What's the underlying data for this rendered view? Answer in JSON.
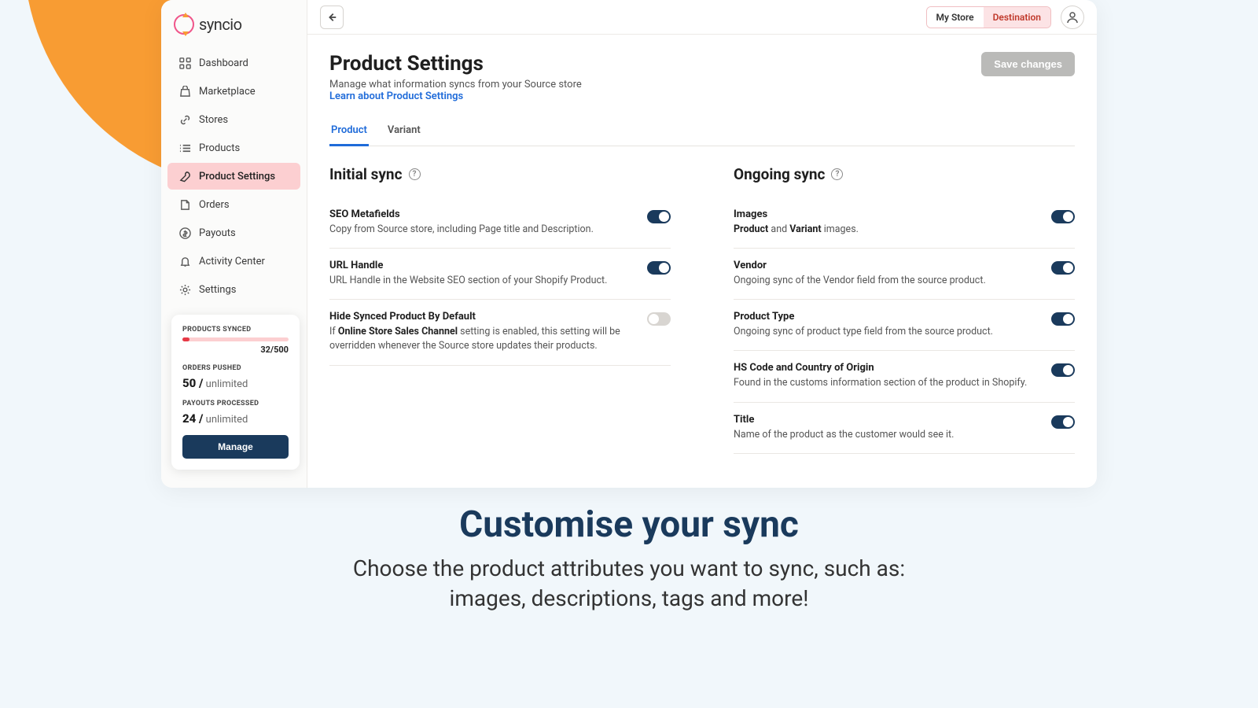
{
  "brand": "syncio",
  "nav": [
    {
      "label": "Dashboard",
      "icon": "grid"
    },
    {
      "label": "Marketplace",
      "icon": "bag"
    },
    {
      "label": "Stores",
      "icon": "link"
    },
    {
      "label": "Products",
      "icon": "list"
    },
    {
      "label": "Product Settings",
      "icon": "wrench",
      "active": true
    },
    {
      "label": "Orders",
      "icon": "file"
    },
    {
      "label": "Payouts",
      "icon": "dollar"
    },
    {
      "label": "Activity Center",
      "icon": "bell"
    },
    {
      "label": "Settings",
      "icon": "cog"
    }
  ],
  "topbar": {
    "my_store": "My Store",
    "destination": "Destination"
  },
  "page": {
    "title": "Product Settings",
    "subtitle": "Manage what information syncs from your Source store",
    "learn": "Learn about Product Settings",
    "save": "Save changes"
  },
  "tabs": [
    {
      "label": "Product",
      "active": true
    },
    {
      "label": "Variant",
      "active": false
    }
  ],
  "initial": {
    "heading": "Initial sync",
    "rows": [
      {
        "title": "SEO Metafields",
        "desc": "Copy from Source store, including Page title and Description.",
        "on": true
      },
      {
        "title": "URL Handle",
        "desc": "URL Handle in the Website SEO section of your Shopify Product.",
        "on": true
      },
      {
        "title": "Hide Synced Product By Default",
        "desc_pre": "If ",
        "desc_bold": "Online Store Sales Channel",
        "desc_post": " setting is enabled, this setting will be overridden whenever the Source store updates their products.",
        "on": false
      }
    ]
  },
  "ongoing": {
    "heading": "Ongoing sync",
    "rows": [
      {
        "title": "Images",
        "desc_pre": "",
        "desc_bold": "Product",
        "desc_mid": " and ",
        "desc_bold2": "Variant",
        "desc_post": " images.",
        "on": true
      },
      {
        "title": "Vendor",
        "desc": "Ongoing sync of the Vendor field from the source product.",
        "on": true
      },
      {
        "title": "Product Type",
        "desc": "Ongoing sync of product type field from the source product.",
        "on": true
      },
      {
        "title": "HS Code and Country of Origin",
        "desc": "Found in the customs information section of the product in Shopify.",
        "on": true
      },
      {
        "title": "Title",
        "desc": "Name of the product as the customer would see it.",
        "on": true
      }
    ]
  },
  "stats": {
    "products_label": "PRODUCTS SYNCED",
    "products_count": "32/500",
    "orders_label": "ORDERS PUSHED",
    "orders_val": "50 /",
    "orders_sub": " unlimited",
    "payouts_label": "PAYOUTS PROCESSED",
    "payouts_val": "24 /",
    "payouts_sub": " unlimited",
    "manage": "Manage"
  },
  "hero": {
    "title": "Customise your sync",
    "line1": "Choose the product attributes you want to sync, such as:",
    "line2": "images, descriptions, tags and more!"
  }
}
